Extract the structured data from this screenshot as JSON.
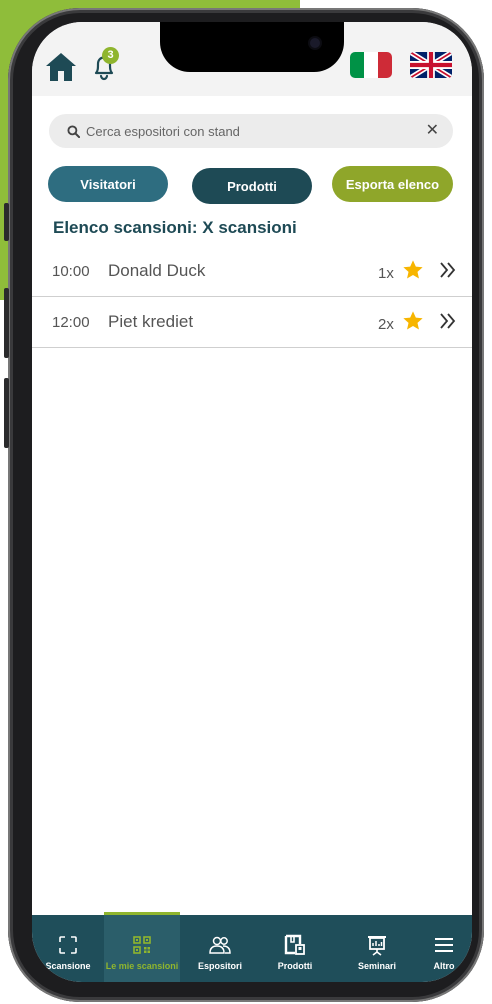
{
  "header": {
    "notifications_count": "3",
    "languages": [
      {
        "name": "italian-flag",
        "colors": [
          "#009246",
          "#ffffff",
          "#ce2b37"
        ]
      },
      {
        "name": "uk-flag",
        "colors": [
          "#012169",
          "#ffffff",
          "#c8102e"
        ]
      }
    ]
  },
  "search": {
    "placeholder": "Cerca espositori con stand",
    "value": ""
  },
  "filters": [
    {
      "label": "Visitatori",
      "color": "#2e6d80"
    },
    {
      "label": "Prodotti",
      "color": "#1e4a55"
    },
    {
      "label": "Esporta elenco",
      "color": "#8fa62a"
    }
  ],
  "list": {
    "title": "Elenco scansioni: X scansioni",
    "rows": [
      {
        "time": "10:00",
        "name": "Donald Duck",
        "count": "1x"
      },
      {
        "time": "12:00",
        "name": "Piet krediet",
        "count": "2x"
      }
    ]
  },
  "bottom_nav": [
    {
      "label": "Scansione",
      "icon": "scan-frame-icon"
    },
    {
      "label": "Le mie scansioni",
      "icon": "qr-code-icon",
      "active": true
    },
    {
      "label": "Espositori",
      "icon": "users-icon"
    },
    {
      "label": "Prodotti",
      "icon": "product-box-icon"
    },
    {
      "label": "Seminari",
      "icon": "presentation-icon"
    },
    {
      "label": "Altro",
      "icon": "menu-icon"
    }
  ],
  "colors": {
    "primary_dark": "#1e4a55",
    "accent_green": "#8fb52e",
    "star": "#f7b500"
  }
}
